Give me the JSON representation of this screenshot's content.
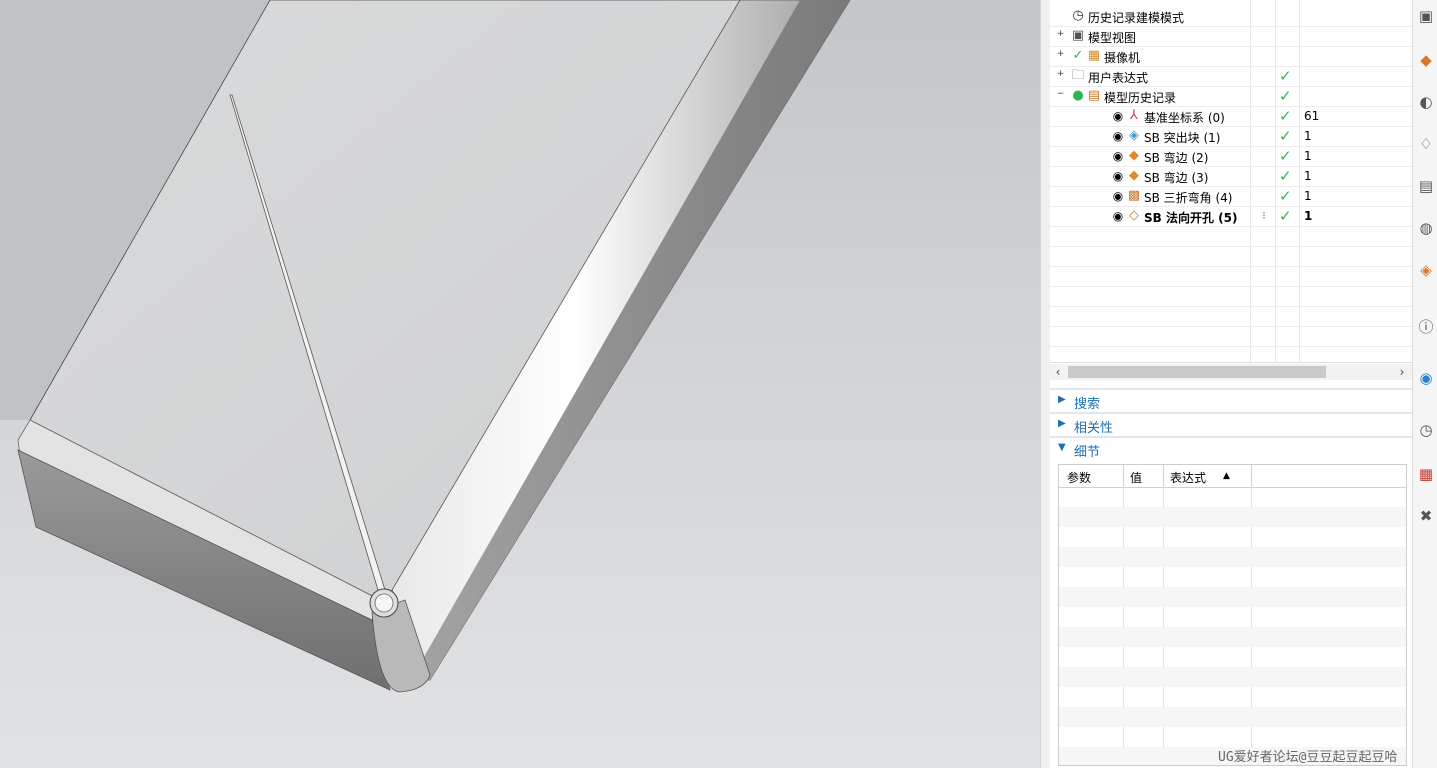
{
  "viewport": {
    "label": "3D model view"
  },
  "navigator": {
    "tree": [
      {
        "label": "历史记录建模模式",
        "icon": "clock-icon",
        "expander": "",
        "check": false,
        "count": "",
        "bold": false
      },
      {
        "label": "模型视图",
        "icon": "model-view-icon",
        "expander": "+",
        "check": false,
        "count": "",
        "bold": false
      },
      {
        "label": "摄像机",
        "icon": "camera-icon",
        "expander": "+",
        "check": false,
        "count": "",
        "bold": false,
        "pre_check": true
      },
      {
        "label": "用户表达式",
        "icon": "folder-icon",
        "expander": "+",
        "check": true,
        "count": "",
        "bold": false
      },
      {
        "label": "模型历史记录",
        "icon": "history-icon",
        "expander": "−",
        "check": true,
        "count": "",
        "bold": false
      },
      {
        "label": "基准坐标系 (0)",
        "icon": "datum-csys-icon",
        "expander": "",
        "check": true,
        "count": "61",
        "bold": false
      },
      {
        "label": "SB 突出块 (1)",
        "icon": "tab-icon",
        "expander": "",
        "check": true,
        "count": "1",
        "bold": false
      },
      {
        "label": "SB 弯边 (2)",
        "icon": "flange-icon",
        "expander": "",
        "check": true,
        "count": "1",
        "bold": false
      },
      {
        "label": "SB 弯边 (3)",
        "icon": "flange-icon",
        "expander": "",
        "check": true,
        "count": "1",
        "bold": false
      },
      {
        "label": "SB 三折弯角 (4)",
        "icon": "corner-icon",
        "expander": "",
        "check": true,
        "count": "1",
        "bold": false
      },
      {
        "label": "SB 法向开孔 (5)",
        "icon": "cutout-icon",
        "expander": "",
        "check": true,
        "count": "1",
        "bold": true
      }
    ],
    "sections": {
      "search": "搜索",
      "relations": "相关性",
      "details": "细节"
    },
    "details_headers": {
      "param": "参数",
      "value": "值",
      "expression": "表达式",
      "sort": "▲"
    }
  },
  "watermark": "UG爱好者论坛@豆豆起豆起豆哈",
  "colors": {
    "check": "#2bb64a",
    "section_text": "#1b6fb5"
  }
}
